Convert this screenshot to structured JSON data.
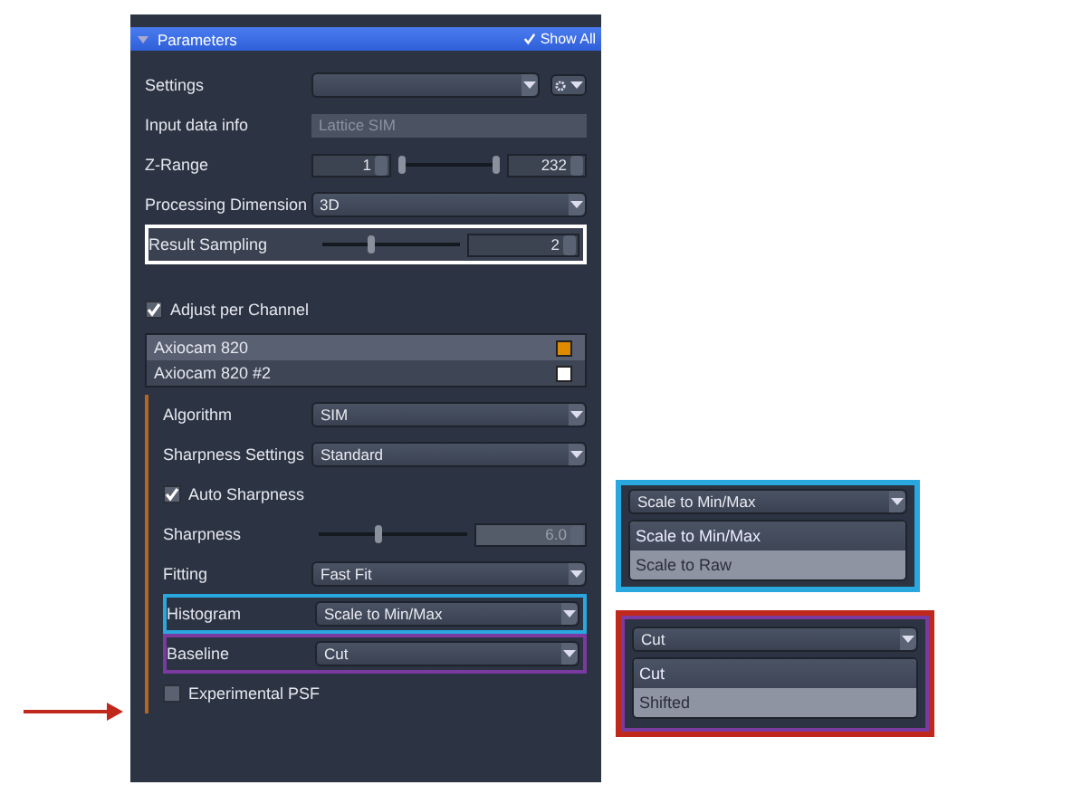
{
  "panel": {
    "title": "Parameters",
    "show_all": {
      "label": "Show All",
      "checked": true
    },
    "rows": [
      {
        "kind": "settings",
        "label": "Settings"
      },
      {
        "kind": "text",
        "label": "Input data info",
        "value": "Lattice SIM"
      },
      {
        "kind": "range",
        "label": "Z-Range",
        "from": "1",
        "to": "232",
        "thumbs": [
          {
            "level": 0
          },
          {
            "level": 1
          }
        ]
      },
      {
        "kind": "dropdown",
        "label": "Processing Dimension",
        "value": "3D"
      },
      {
        "kind": "slider",
        "label": "Result Sampling",
        "level": 0.35,
        "value": "2",
        "color": "#ffffff"
      },
      {
        "kind": "checkbox",
        "label": "Adjust per Channel",
        "checked": true
      }
    ],
    "channels": [
      {
        "name": "Axiocam 820",
        "selected": true,
        "color": "#e08a00"
      },
      {
        "name": "Axiocam 820 #2",
        "selected": false,
        "color": "#ffffff"
      }
    ],
    "channel_rows": [
      {
        "kind": "dropdown",
        "label": "Algorithm",
        "value": "SIM"
      },
      {
        "kind": "dropdown",
        "label": "Sharpness Settings",
        "value": "Standard"
      },
      {
        "kind": "checkbox",
        "label": "Auto Sharpness",
        "checked": true
      },
      {
        "kind": "slider",
        "label": "Sharpness",
        "level": 0.4,
        "value": "6.0",
        "disabled": true
      },
      {
        "kind": "dropdown",
        "label": "Fitting",
        "value": "Fast Fit"
      },
      {
        "kind": "dropdown",
        "label": "Histogram",
        "value": "Scale to Min/Max",
        "color": "#29a8e0"
      },
      {
        "kind": "dropdown",
        "label": "Baseline",
        "value": "Cut",
        "color": "#7a3aa0"
      },
      {
        "kind": "checkbox",
        "label": "Experimental PSF",
        "checked": false
      }
    ]
  },
  "callouts": [
    {
      "value": "Scale to Min/Max",
      "color": "#29a8e0",
      "options": [
        {
          "label": "Scale to Min/Max",
          "selected": true
        },
        {
          "label": "Scale to Raw",
          "selected": false
        }
      ]
    },
    {
      "value": "Cut",
      "color": "#c0281c",
      "inner": {
        "color": "#7a3aa0"
      },
      "options": [
        {
          "label": "Cut",
          "selected": true
        },
        {
          "label": "Shifted",
          "selected": false
        }
      ]
    }
  ]
}
